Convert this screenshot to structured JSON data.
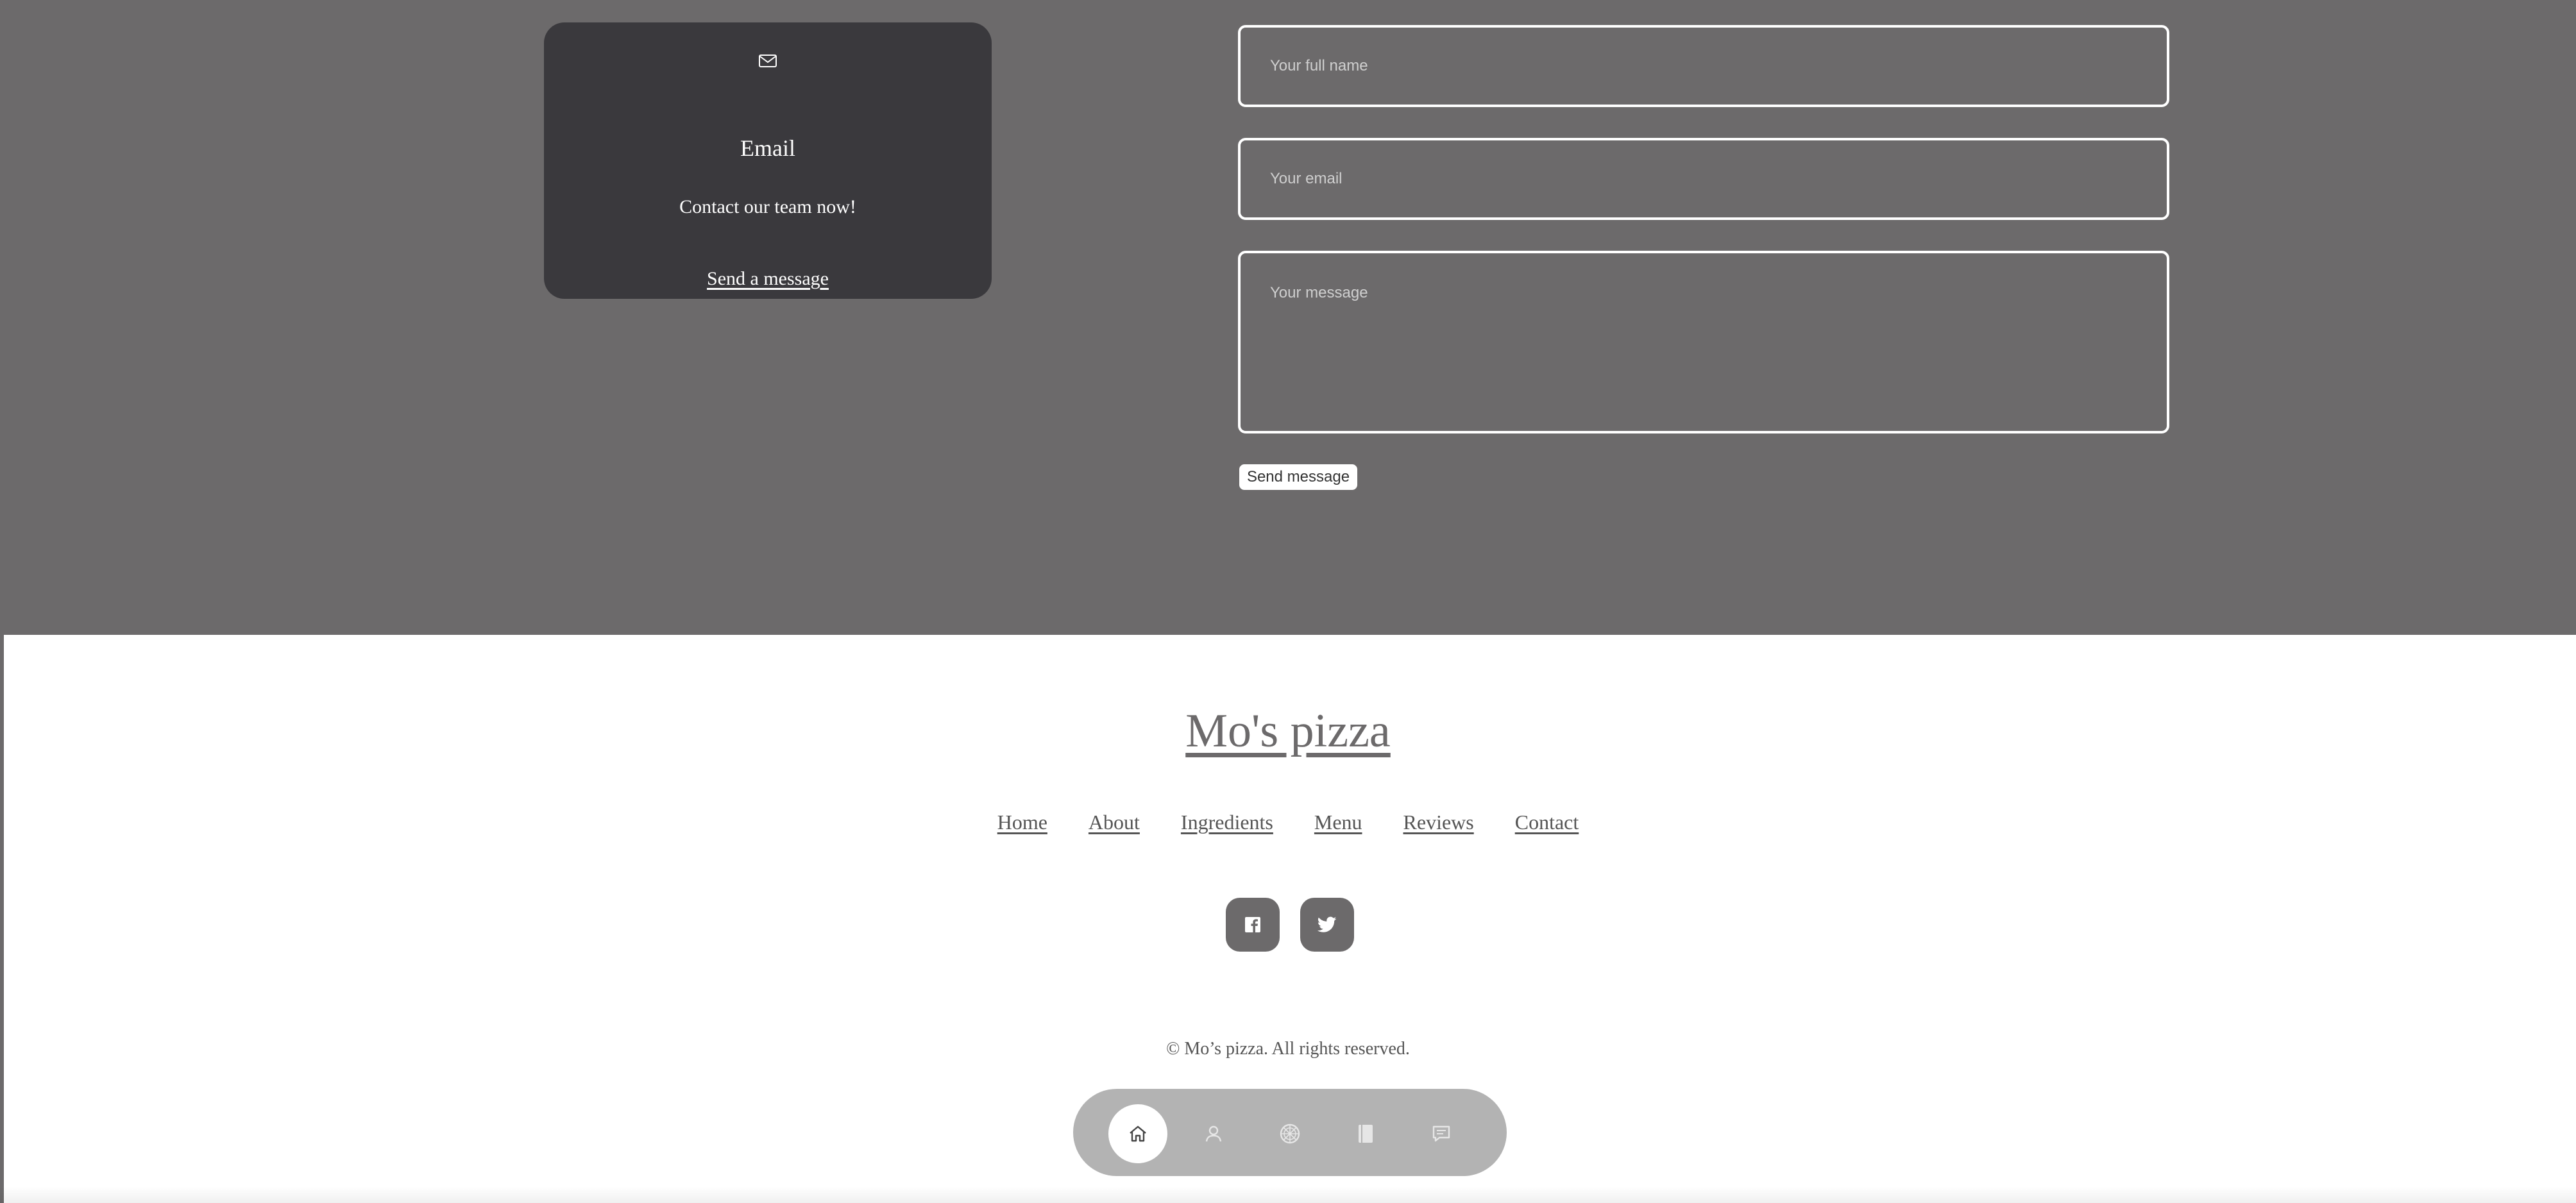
{
  "contact_card": {
    "icon": "mail-icon",
    "title": "Email",
    "text": "Contact our team now!",
    "link_label": "Send a message"
  },
  "form": {
    "name_placeholder": "Your full name",
    "email_placeholder": "Your email",
    "message_placeholder": "Your message",
    "submit_label": "Send message"
  },
  "footer": {
    "logo": "Mo's pizza",
    "nav": [
      "Home",
      "About",
      "Ingredients",
      "Menu",
      "Reviews",
      "Contact"
    ],
    "social": [
      "facebook-icon",
      "twitter-icon"
    ],
    "copyright": "© Mo’s pizza. All rights reserved."
  },
  "bottom_nav": {
    "items": [
      "home-icon",
      "user-icon",
      "pizza-icon",
      "menu-book-icon",
      "chat-icon"
    ],
    "active": "home-icon"
  },
  "colors": {
    "section_bg": "#6c6a6b",
    "card_bg": "#3a393d",
    "bottom_bar_bg": "#b3b3b3",
    "footer_text": "#555555"
  }
}
